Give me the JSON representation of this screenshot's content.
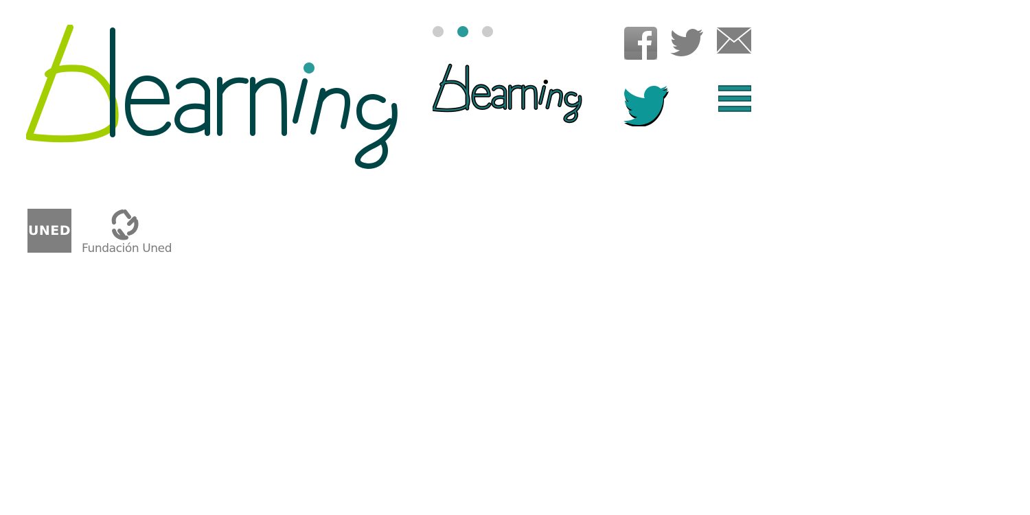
{
  "header": {
    "logo_text": "blearning",
    "small_logo_text": "blearning",
    "slider": {
      "dot_count": 3,
      "active_index": 1
    }
  },
  "social": {
    "facebook_icon": "facebook-icon",
    "twitter_icon": "twitter-icon",
    "mail_icon": "mail-icon",
    "twitter_teal_icon": "twitter-icon",
    "menu_icon": "hamburger-menu-icon"
  },
  "footer": {
    "uned_logo_text": "UNED",
    "fundacion_text": "Fundación Uned"
  },
  "colors": {
    "lime": "#a3cf00",
    "dark_teal": "#004545",
    "teal": "#2b9a9a",
    "grey": "#7f7f7f",
    "dot_inactive": "#cccccc"
  }
}
